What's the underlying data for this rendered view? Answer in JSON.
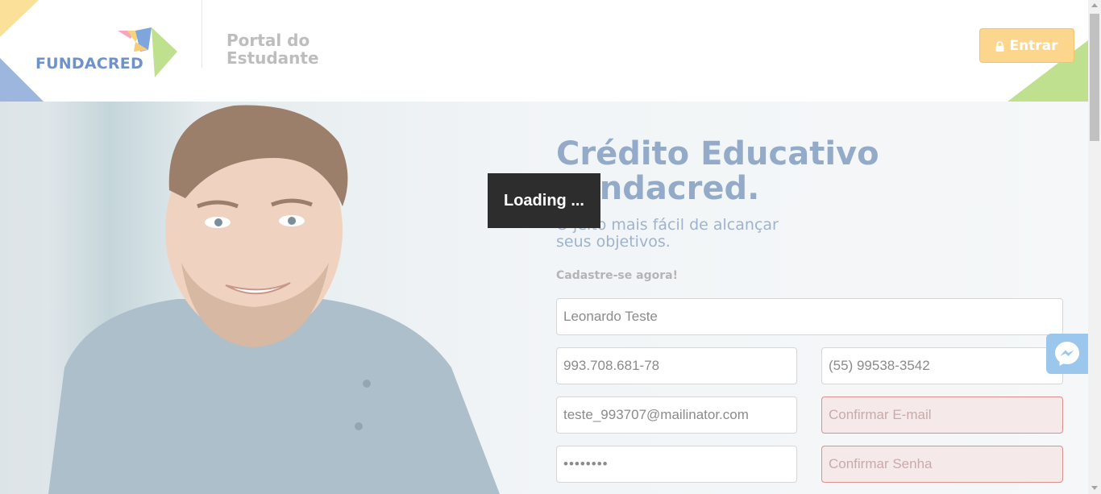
{
  "header": {
    "logo_text": "FUNDACRED",
    "portal_title_line1": "Portal do",
    "portal_title_line2": "Estudante",
    "login_button_label": "Entrar"
  },
  "hero": {
    "headline_line1": "Crédito Educativo",
    "headline_line2": "Fundacred.",
    "subline_line1": "O jeito mais fácil de alcançar",
    "subline_line2": "seus objetivos.",
    "cta": "Cadastre-se agora!"
  },
  "form": {
    "name": "Leonardo Teste",
    "cpf": "993.708.681-78",
    "phone": "(55) 99538-3542",
    "email": "teste_993707@mailinator.com",
    "confirm_email_placeholder": "Confirmar E-mail",
    "password_masked": "••••••••",
    "confirm_password_placeholder": "Confirmar Senha"
  },
  "overlay": {
    "loading_text": "Loading ..."
  },
  "colors": {
    "brand_blue": "#6f93c9",
    "entrar_button": "#fbd68c",
    "error_border": "#d9908f",
    "messenger": "#9cc7ec"
  }
}
